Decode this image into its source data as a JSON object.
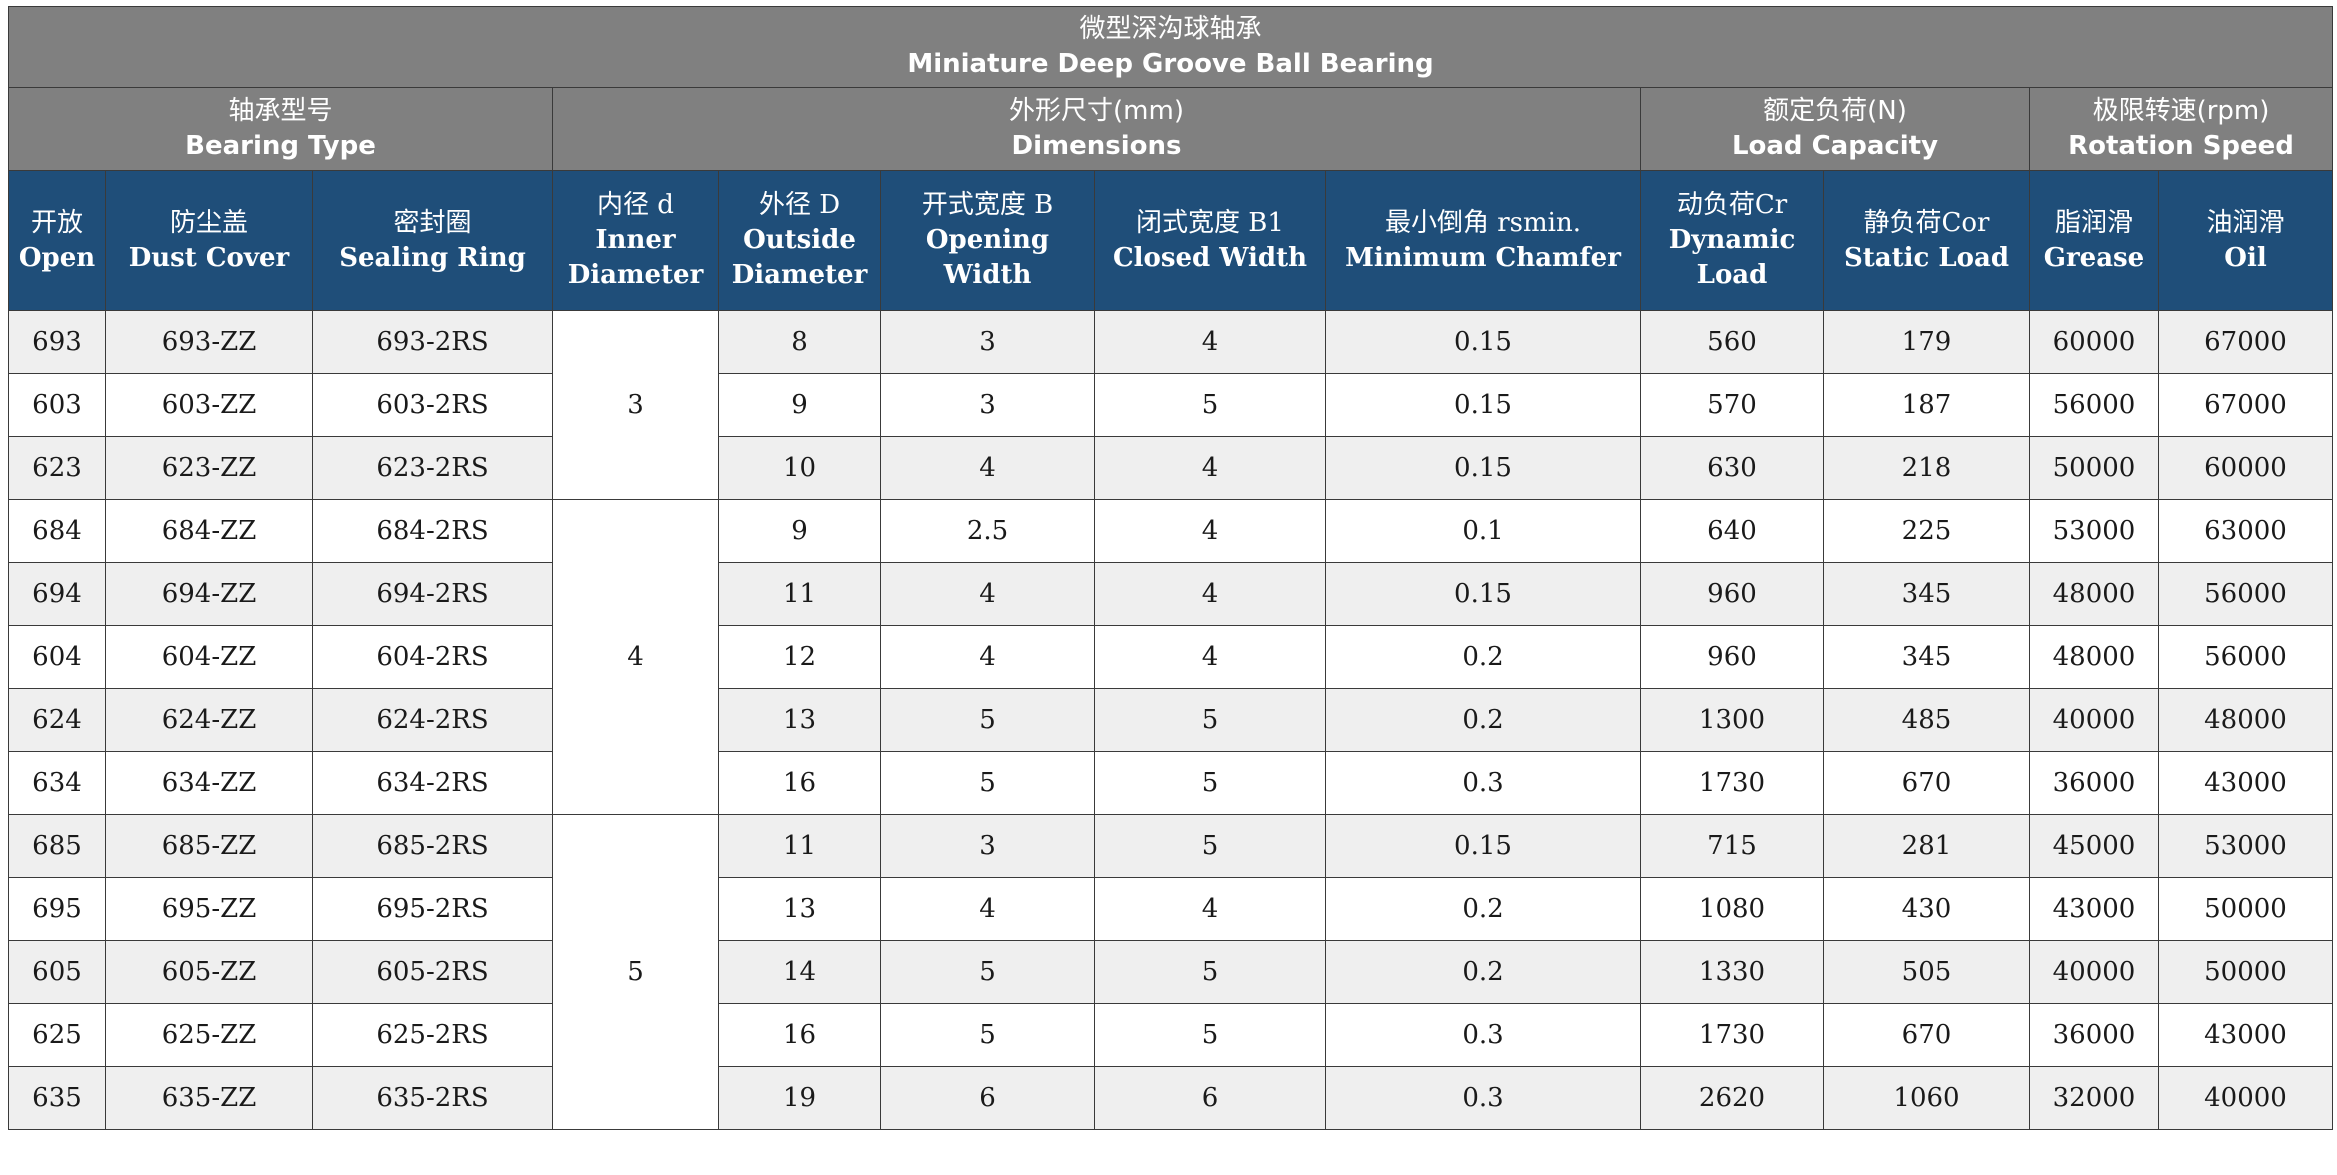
{
  "title": {
    "zh": "微型深沟球轴承",
    "en": "Miniature Deep Groove Ball Bearing"
  },
  "groups": [
    {
      "zh": "轴承型号",
      "en": "Bearing Type"
    },
    {
      "zh": "外形尺寸(mm)",
      "en": "Dimensions"
    },
    {
      "zh": "额定负荷(N)",
      "en": "Load Capacity"
    },
    {
      "zh": "极限转速(rpm)",
      "en": "Rotation Speed"
    }
  ],
  "columns": [
    {
      "zh": "开放",
      "en": "Open"
    },
    {
      "zh": "防尘盖",
      "en": "Dust Cover"
    },
    {
      "zh": "密封圈",
      "en": "Sealing Ring"
    },
    {
      "zh": "内径 d",
      "en": "Inner Diameter"
    },
    {
      "zh": "外径 D",
      "en": "Outside Diameter"
    },
    {
      "zh": "开式宽度 B",
      "en": "Opening Width"
    },
    {
      "zh": "闭式宽度 B1",
      "en": "Closed Width"
    },
    {
      "zh": "最小倒角 rsmin.",
      "en": "Minimum Chamfer"
    },
    {
      "zh": "动负荷Cr",
      "en": "Dynamic Load"
    },
    {
      "zh": "静负荷Cor",
      "en": "Static Load"
    },
    {
      "zh": "脂润滑",
      "en": "Grease"
    },
    {
      "zh": "油润滑",
      "en": "Oil"
    }
  ],
  "inner_diameter_groups": [
    {
      "value": "3",
      "rows": 3
    },
    {
      "value": "4",
      "rows": 5
    },
    {
      "value": "5",
      "rows": 5
    }
  ],
  "rows": [
    {
      "open": "693",
      "zz": "693-ZZ",
      "rs": "693-2RS",
      "D": "8",
      "B": "3",
      "B1": "4",
      "r": "0.15",
      "cr": "560",
      "cor": "179",
      "grease": "60000",
      "oil": "67000"
    },
    {
      "open": "603",
      "zz": "603-ZZ",
      "rs": "603-2RS",
      "D": "9",
      "B": "3",
      "B1": "5",
      "r": "0.15",
      "cr": "570",
      "cor": "187",
      "grease": "56000",
      "oil": "67000"
    },
    {
      "open": "623",
      "zz": "623-ZZ",
      "rs": "623-2RS",
      "D": "10",
      "B": "4",
      "B1": "4",
      "r": "0.15",
      "cr": "630",
      "cor": "218",
      "grease": "50000",
      "oil": "60000"
    },
    {
      "open": "684",
      "zz": "684-ZZ",
      "rs": "684-2RS",
      "D": "9",
      "B": "2.5",
      "B1": "4",
      "r": "0.1",
      "cr": "640",
      "cor": "225",
      "grease": "53000",
      "oil": "63000"
    },
    {
      "open": "694",
      "zz": "694-ZZ",
      "rs": "694-2RS",
      "D": "11",
      "B": "4",
      "B1": "4",
      "r": "0.15",
      "cr": "960",
      "cor": "345",
      "grease": "48000",
      "oil": "56000"
    },
    {
      "open": "604",
      "zz": "604-ZZ",
      "rs": "604-2RS",
      "D": "12",
      "B": "4",
      "B1": "4",
      "r": "0.2",
      "cr": "960",
      "cor": "345",
      "grease": "48000",
      "oil": "56000"
    },
    {
      "open": "624",
      "zz": "624-ZZ",
      "rs": "624-2RS",
      "D": "13",
      "B": "5",
      "B1": "5",
      "r": "0.2",
      "cr": "1300",
      "cor": "485",
      "grease": "40000",
      "oil": "48000"
    },
    {
      "open": "634",
      "zz": "634-ZZ",
      "rs": "634-2RS",
      "D": "16",
      "B": "5",
      "B1": "5",
      "r": "0.3",
      "cr": "1730",
      "cor": "670",
      "grease": "36000",
      "oil": "43000"
    },
    {
      "open": "685",
      "zz": "685-ZZ",
      "rs": "685-2RS",
      "D": "11",
      "B": "3",
      "B1": "5",
      "r": "0.15",
      "cr": "715",
      "cor": "281",
      "grease": "45000",
      "oil": "53000"
    },
    {
      "open": "695",
      "zz": "695-ZZ",
      "rs": "695-2RS",
      "D": "13",
      "B": "4",
      "B1": "4",
      "r": "0.2",
      "cr": "1080",
      "cor": "430",
      "grease": "43000",
      "oil": "50000"
    },
    {
      "open": "605",
      "zz": "605-ZZ",
      "rs": "605-2RS",
      "D": "14",
      "B": "5",
      "B1": "5",
      "r": "0.2",
      "cr": "1330",
      "cor": "505",
      "grease": "40000",
      "oil": "50000"
    },
    {
      "open": "625",
      "zz": "625-ZZ",
      "rs": "625-2RS",
      "D": "16",
      "B": "5",
      "B1": "5",
      "r": "0.3",
      "cr": "1730",
      "cor": "670",
      "grease": "36000",
      "oil": "43000"
    },
    {
      "open": "635",
      "zz": "635-ZZ",
      "rs": "635-2RS",
      "D": "19",
      "B": "6",
      "B1": "6",
      "r": "0.3",
      "cr": "2620",
      "cor": "1060",
      "grease": "32000",
      "oil": "40000"
    }
  ]
}
